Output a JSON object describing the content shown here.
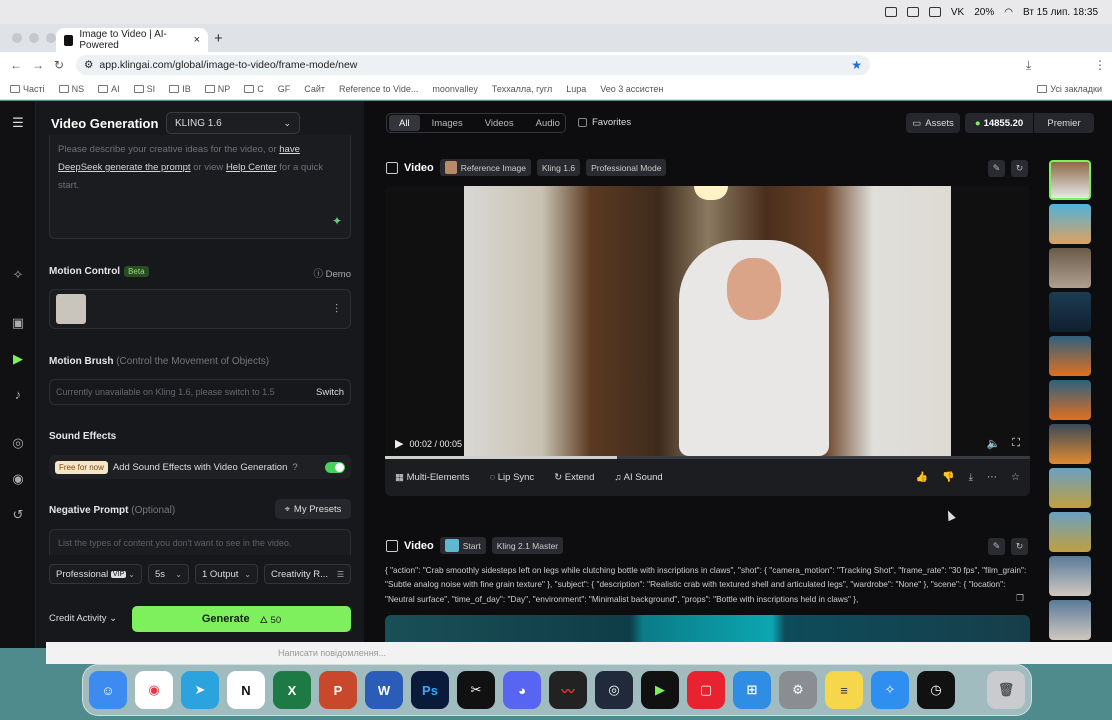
{
  "menubar": {
    "date_time": "Вт 15 лип.  18:35",
    "battery": "20%",
    "lang": "VK"
  },
  "browser": {
    "tab_title": "Image to Video | AI-Powered",
    "url": "app.klingai.com/global/image-to-video/frame-mode/new",
    "bookmarks": [
      "Часті",
      "NS",
      "AI",
      "SI",
      "IB",
      "NP",
      "C",
      "",
      "",
      "",
      "",
      "GF",
      "",
      "Сайт",
      "Reference to Vide...",
      "moonvalley",
      "Теххалла, гугл",
      "Lupa",
      "Veo 3 ассистен"
    ],
    "all_bookmarks": "Усі закладки"
  },
  "panel": {
    "title": "Video Generation",
    "model": "KLING 1.6",
    "prompt_placeholder_a": "Please describe your creative ideas for the video, or",
    "prompt_link_a": "have DeepSeek generate the prompt",
    "prompt_mid": "or view",
    "prompt_link_b": "Help Center",
    "prompt_tail": "for a quick start.",
    "motion_control": "Motion Control",
    "beta": "Beta",
    "demo": "Demo",
    "motion_brush": "Motion Brush",
    "motion_brush_hint": "(Control the Movement of Objects)",
    "motion_brush_unavailable": "Currently unavailable on Kling 1.6, please switch to 1.5",
    "switch": "Switch",
    "sound_effects": "Sound Effects",
    "free_for_now": "Free for now",
    "add_sound": "Add Sound Effects with Video Generation",
    "negative_prompt": "Negative Prompt",
    "optional": "(Optional)",
    "my_presets": "My Presets",
    "neg_placeholder": "List the types of content you don't want to see in the video.",
    "opt_mode": "Professional",
    "opt_vip": "VIP",
    "opt_duration": "5s",
    "opt_output": "1 Output",
    "opt_creativity": "Creativity R...",
    "credit_activity": "Credit Activity",
    "generate": "Generate",
    "generate_cost": "50"
  },
  "main": {
    "filters": [
      "All",
      "Images",
      "Videos",
      "Audio"
    ],
    "favorites": "Favorites",
    "assets": "Assets",
    "credits": "14855.20",
    "plan": "Premier",
    "video1": {
      "label": "Video",
      "chips": [
        "Reference Image",
        "Kling 1.6",
        "Professional Mode"
      ],
      "time": "00:02 / 00:05",
      "watermark": "KLING AI 1.6",
      "progress": 0.36
    },
    "actions": [
      "Multi-Elements",
      "Lip Sync",
      "Extend",
      "AI Sound"
    ],
    "video2": {
      "label": "Video",
      "chips": [
        "Start",
        "Kling 2.1 Master"
      ],
      "prompt": "{ \"action\": \"Crab smoothly sidesteps left on legs while clutching bottle with inscriptions in claws\", \"shot\": { \"camera_motion\": \"Tracking Shot\", \"frame_rate\": \"30 fps\", \"film_grain\": \"Subtle analog noise with fine grain texture\" }, \"subject\": { \"description\": \"Realistic crab with textured shell and articulated legs\", \"wardrobe\": \"None\" }, \"scene\": { \"location\": \"Neutral surface\", \"time_of_day\": \"Day\", \"environment\": \"Minimalist background\", \"props\": \"Bottle with inscriptions held in claws\" },"
    }
  },
  "chat_placeholder": "Написати повідомлення...",
  "colors": {
    "accent": "#7ef05e",
    "bg": "#0d0d0f",
    "panel": "#17181b"
  }
}
